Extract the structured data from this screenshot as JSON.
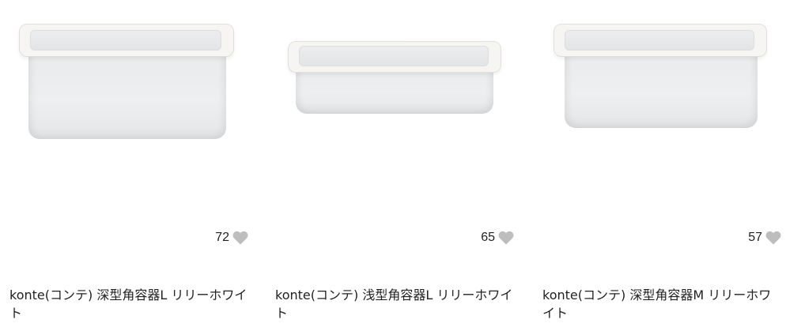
{
  "colors": {
    "heart": "#bdbdbd",
    "text": "#222222",
    "background": "#ffffff"
  },
  "products": [
    {
      "like_count": "72",
      "like_icon": "heart-icon",
      "title": "konte(コンテ) 深型角容器L リリーホワイト"
    },
    {
      "like_count": "65",
      "like_icon": "heart-icon",
      "title": "konte(コンテ) 浅型角容器L リリーホワイト"
    },
    {
      "like_count": "57",
      "like_icon": "heart-icon",
      "title": "konte(コンテ) 深型角容器M リリーホワイト"
    }
  ]
}
